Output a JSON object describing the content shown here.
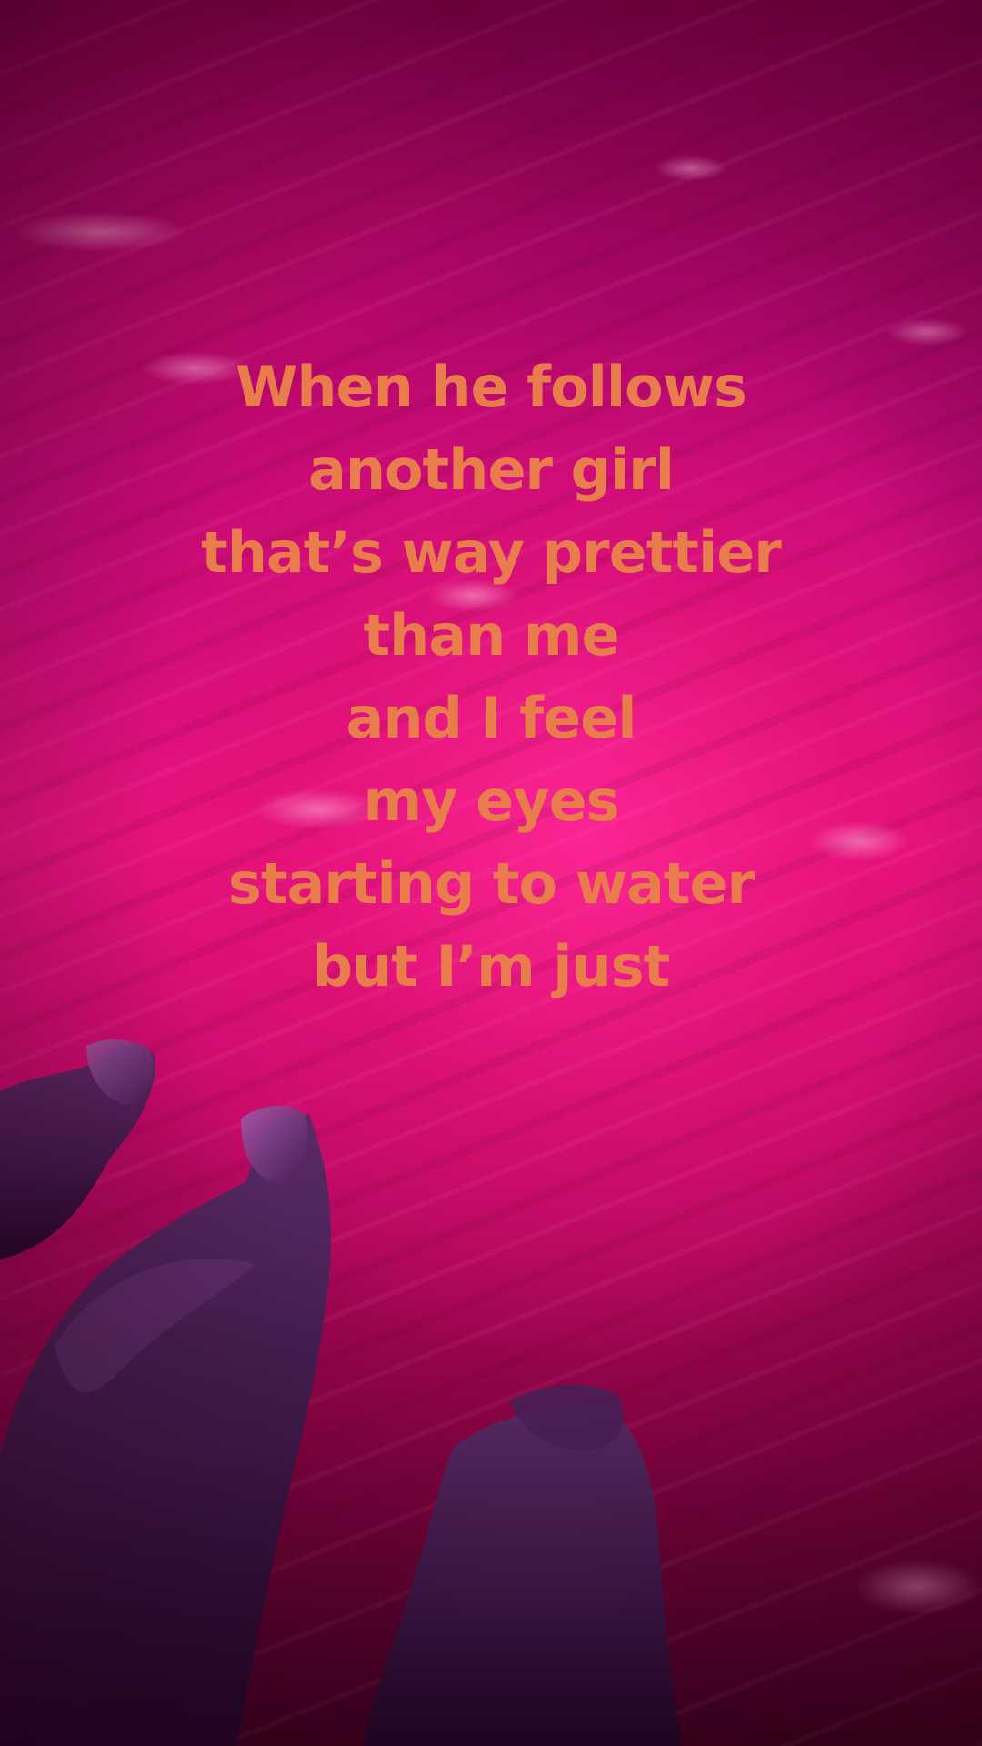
{
  "caption": {
    "lines": [
      "When he follows",
      "another girl",
      "that’s way prettier",
      "than me",
      "and I feel",
      "my eyes",
      "starting to water",
      "but I’m just"
    ],
    "color": "#e87c4c"
  },
  "background": {
    "description_colors": [
      "#e8127f",
      "#7a0045",
      "#3a0020"
    ],
    "legs_color": "#3a1848"
  }
}
